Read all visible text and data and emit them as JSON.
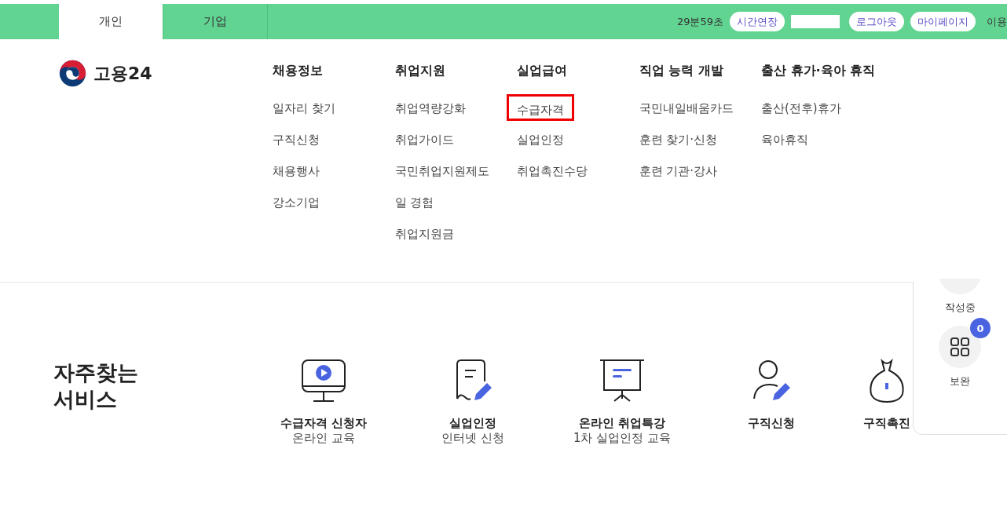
{
  "top_bar": {
    "tabs": [
      {
        "label": "개인",
        "selected": true
      },
      {
        "label": "기업",
        "selected": false
      }
    ],
    "timer": "29분59초",
    "buttons": [
      "시간연장",
      "로그아웃",
      "마이페이지"
    ],
    "cut_text": "이용"
  },
  "logo": {
    "text": "고용24"
  },
  "menu": [
    {
      "heading": "채용정보",
      "items": [
        {
          "label": "일자리 찾기",
          "selected": false
        },
        {
          "label": "구직신청",
          "selected": false
        },
        {
          "label": "채용행사",
          "selected": false
        },
        {
          "label": "강소기업",
          "selected": false
        }
      ]
    },
    {
      "heading": "취업지원",
      "items": [
        {
          "label": "취업역량강화",
          "selected": false
        },
        {
          "label": "취업가이드",
          "selected": false
        },
        {
          "label": "국민취업지원제도",
          "selected": false
        },
        {
          "label": "일 경험",
          "selected": false
        },
        {
          "label": "취업지원금",
          "selected": false
        }
      ]
    },
    {
      "heading": "실업급여",
      "items": [
        {
          "label": "수급자격",
          "selected": true
        },
        {
          "label": "실업인정",
          "selected": false
        },
        {
          "label": "취업촉진수당",
          "selected": false
        }
      ]
    },
    {
      "heading": "직업 능력 개발",
      "items": [
        {
          "label": "국민내일배움카드",
          "selected": false
        },
        {
          "label": "훈련 찾기·신청",
          "selected": false
        },
        {
          "label": "훈련 기관·강사",
          "selected": false
        }
      ]
    },
    {
      "heading": "출산 휴가·육아 휴직",
      "items": [
        {
          "label": "출산(전후)휴가",
          "selected": false
        },
        {
          "label": "육아휴직",
          "selected": false
        }
      ]
    }
  ],
  "services": {
    "title": "자주찾는 서비스",
    "items": [
      {
        "kind": "monitor",
        "title": "수급자격 신청자",
        "subtitle": "온라인 교육"
      },
      {
        "kind": "document",
        "title": "실업인정",
        "subtitle": "인터넷 신청"
      },
      {
        "kind": "board",
        "title": "온라인 취업특강",
        "subtitle": "1차 실업인정 교육"
      },
      {
        "kind": "person",
        "title": "구직신청"
      },
      {
        "kind": "bag",
        "title": "구직촉진"
      }
    ]
  },
  "side_panel": {
    "items": [
      {
        "label": "작성중"
      },
      {
        "label": "보완",
        "badge": "0"
      }
    ]
  }
}
